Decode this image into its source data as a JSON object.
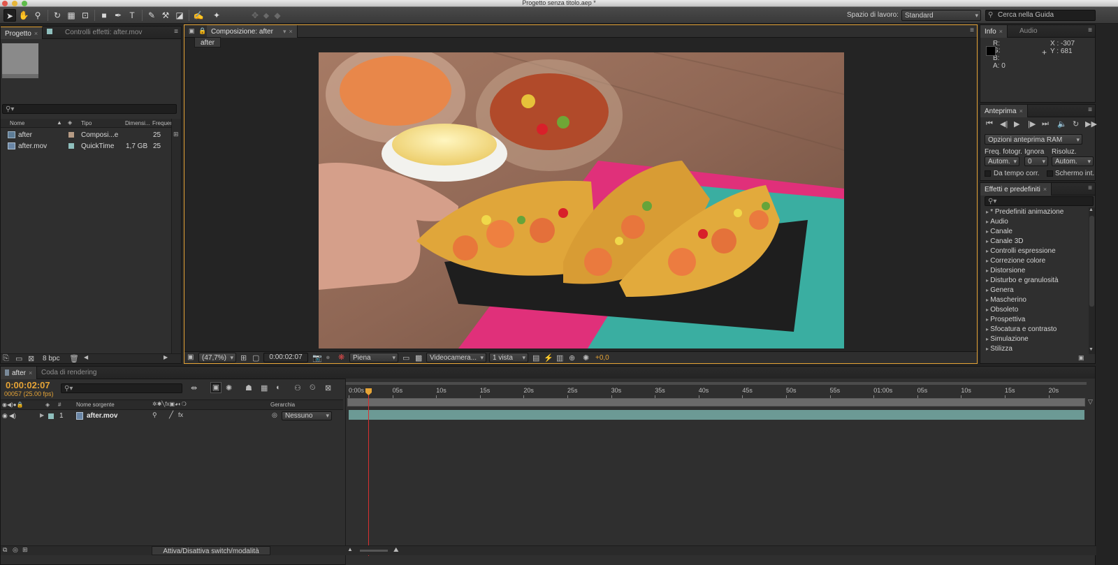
{
  "app": {
    "window_title": "Progetto senza titolo.aep *"
  },
  "toolbar": {
    "workspace_label": "Spazio di lavoro:",
    "workspace_value": "Standard",
    "help_search_placeholder": "Cerca nella Guida"
  },
  "project_panel": {
    "tab_project": "Progetto",
    "tab_effects": "Controlli effetti: after.mov",
    "columns": [
      "Nome",
      "Tipo",
      "Dimensi...",
      "Frequen..."
    ],
    "items": [
      {
        "name": "after",
        "type": "Composi...e",
        "size": "",
        "fps": "25",
        "label_color": "#b69b84"
      },
      {
        "name": "after.mov",
        "type": "QuickTime",
        "size": "1,7 GB",
        "fps": "25",
        "label_color": "#8fbfbd"
      }
    ],
    "bpc": "8 bpc"
  },
  "composition_panel": {
    "tab": "Composizione: after",
    "breadcrumb": "after",
    "zoom": "(47,7%)",
    "timecode": "0:00:02:07",
    "resolution": "Piena",
    "camera": "Videocamera...",
    "views": "1 vista",
    "exposure": "+0,0"
  },
  "info_panel": {
    "tab_info": "Info",
    "tab_audio": "Audio",
    "r": "R:",
    "g": "G:",
    "b": "B:",
    "a": "A:  0",
    "x": "X : -307",
    "y": "Y : 681"
  },
  "preview_panel": {
    "tab": "Anteprima",
    "ram_options": "Opzioni anteprima RAM",
    "frame_rate_label": "Freq. fotogr.",
    "skip_label": "Ignora",
    "resolution_label": "Risoluz.",
    "frame_rate_value": "Autom.",
    "skip_value": "0",
    "resolution_value": "Autom.",
    "from_current": "Da tempo corr.",
    "full_screen": "Schermo int."
  },
  "effects_panel": {
    "tab": "Effetti e predefiniti",
    "items": [
      "* Predefiniti animazione",
      "Audio",
      "Canale",
      "Canale 3D",
      "Controlli espressione",
      "Correzione colore",
      "Distorsione",
      "Disturbo e granulosità",
      "Genera",
      "Mascherino",
      "Obsoleto",
      "Prospettiva",
      "Sfocatura e contrasto",
      "Simulazione",
      "Stilizza"
    ]
  },
  "timeline": {
    "tab_comp": "after",
    "tab_render": "Coda di rendering",
    "timecode": "0:00:02:07",
    "frame_info": "00057 (25.00 fps)",
    "col_num": "#",
    "col_source": "Nome sorgente",
    "col_parent": "Gerarchia",
    "layer_number": "1",
    "layer_name": "after.mov",
    "layer_parent": "Nessuno",
    "ruler": [
      "0:00s",
      "05s",
      "10s",
      "15s",
      "20s",
      "25s",
      "30s",
      "35s",
      "40s",
      "45s",
      "50s",
      "55s",
      "01:00s",
      "05s",
      "10s",
      "15s",
      "20s"
    ],
    "toggle_label": "Attiva/Disattiva switch/modalità"
  }
}
